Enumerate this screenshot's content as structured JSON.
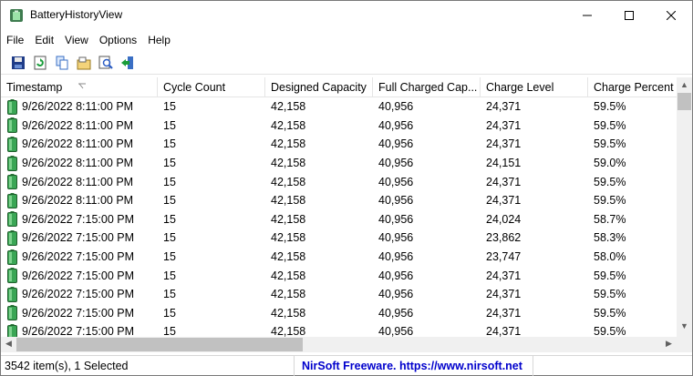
{
  "window": {
    "title": "BatteryHistoryView",
    "icon": "battery-app-icon"
  },
  "menu": [
    "File",
    "Edit",
    "View",
    "Options",
    "Help"
  ],
  "toolbar": [
    "save-icon",
    "refresh-icon",
    "copy-icon",
    "properties-icon",
    "find-icon",
    "exit-icon"
  ],
  "columns": [
    "Timestamp",
    "Cycle Count",
    "Designed Capacity",
    "Full Charged Cap...",
    "Charge Level",
    "Charge Percent"
  ],
  "sorted_column": "Timestamp",
  "rows": [
    [
      "9/26/2022 8:11:00 PM",
      "15",
      "42,158",
      "40,956",
      "24,371",
      "59.5%"
    ],
    [
      "9/26/2022 8:11:00 PM",
      "15",
      "42,158",
      "40,956",
      "24,371",
      "59.5%"
    ],
    [
      "9/26/2022 8:11:00 PM",
      "15",
      "42,158",
      "40,956",
      "24,371",
      "59.5%"
    ],
    [
      "9/26/2022 8:11:00 PM",
      "15",
      "42,158",
      "40,956",
      "24,151",
      "59.0%"
    ],
    [
      "9/26/2022 8:11:00 PM",
      "15",
      "42,158",
      "40,956",
      "24,371",
      "59.5%"
    ],
    [
      "9/26/2022 8:11:00 PM",
      "15",
      "42,158",
      "40,956",
      "24,371",
      "59.5%"
    ],
    [
      "9/26/2022 7:15:00 PM",
      "15",
      "42,158",
      "40,956",
      "24,024",
      "58.7%"
    ],
    [
      "9/26/2022 7:15:00 PM",
      "15",
      "42,158",
      "40,956",
      "23,862",
      "58.3%"
    ],
    [
      "9/26/2022 7:15:00 PM",
      "15",
      "42,158",
      "40,956",
      "23,747",
      "58.0%"
    ],
    [
      "9/26/2022 7:15:00 PM",
      "15",
      "42,158",
      "40,956",
      "24,371",
      "59.5%"
    ],
    [
      "9/26/2022 7:15:00 PM",
      "15",
      "42,158",
      "40,956",
      "24,371",
      "59.5%"
    ],
    [
      "9/26/2022 7:15:00 PM",
      "15",
      "42,158",
      "40,956",
      "24,371",
      "59.5%"
    ],
    [
      "9/26/2022 7:15:00 PM",
      "15",
      "42,158",
      "40,956",
      "24,371",
      "59.5%"
    ]
  ],
  "status": {
    "count": "3542 item(s), 1 Selected",
    "link": "NirSoft Freeware. https://www.nirsoft.net"
  },
  "colors": {
    "battery": "#3aa655",
    "link": "#0000cc"
  }
}
